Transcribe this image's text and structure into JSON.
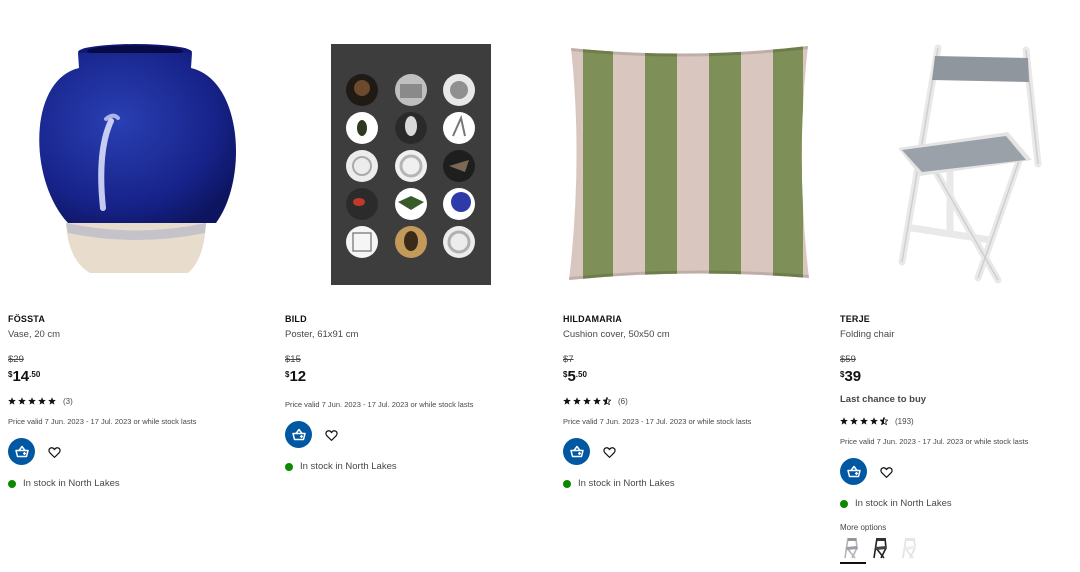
{
  "colors": {
    "cart_button": "#0058a3",
    "in_stock_dot": "#0a8a00",
    "rating_star": "#111111"
  },
  "products": [
    {
      "name": "FÖSSTA",
      "description": "Vase, 20 cm",
      "old_price": "$29",
      "price_currency": "$",
      "price_integer": "14",
      "price_decimal": ".50",
      "rating_stars": 5,
      "rating_count": "(3)",
      "validity": "Price valid 7 Jun. 2023 - 17 Jul. 2023 or while stock lasts",
      "stock": "In stock in North Lakes",
      "image_icon": "blue-vase-image"
    },
    {
      "name": "BILD",
      "description": "Poster, 61x91 cm",
      "old_price": "$15",
      "price_currency": "$",
      "price_integer": "12",
      "price_decimal": "",
      "validity": "Price valid 7 Jun. 2023 - 17 Jul. 2023 or while stock lasts",
      "stock": "In stock in North Lakes",
      "image_icon": "poster-image"
    },
    {
      "name": "HILDAMARIA",
      "description": "Cushion cover, 50x50 cm",
      "old_price": "$7",
      "price_currency": "$",
      "price_integer": "5",
      "price_decimal": ".50",
      "rating_stars": 4.5,
      "rating_count": "(6)",
      "validity": "Price valid 7 Jun. 2023 - 17 Jul. 2023 or while stock lasts",
      "stock": "In stock in North Lakes",
      "image_icon": "striped-cushion-image"
    },
    {
      "name": "TERJE",
      "description": "Folding chair",
      "old_price": "$59",
      "price_currency": "$",
      "price_integer": "39",
      "price_decimal": "",
      "last_chance": "Last chance to buy",
      "rating_stars": 4.5,
      "rating_count": "(193)",
      "validity": "Price valid 7 Jun. 2023 - 17 Jul. 2023 or while stock lasts",
      "stock": "In stock in North Lakes",
      "more_options": "More options",
      "variant_icons": [
        "chair-white-variant-icon",
        "chair-black-variant-icon",
        "chair-light-variant-icon"
      ],
      "image_icon": "folding-chair-image"
    }
  ]
}
